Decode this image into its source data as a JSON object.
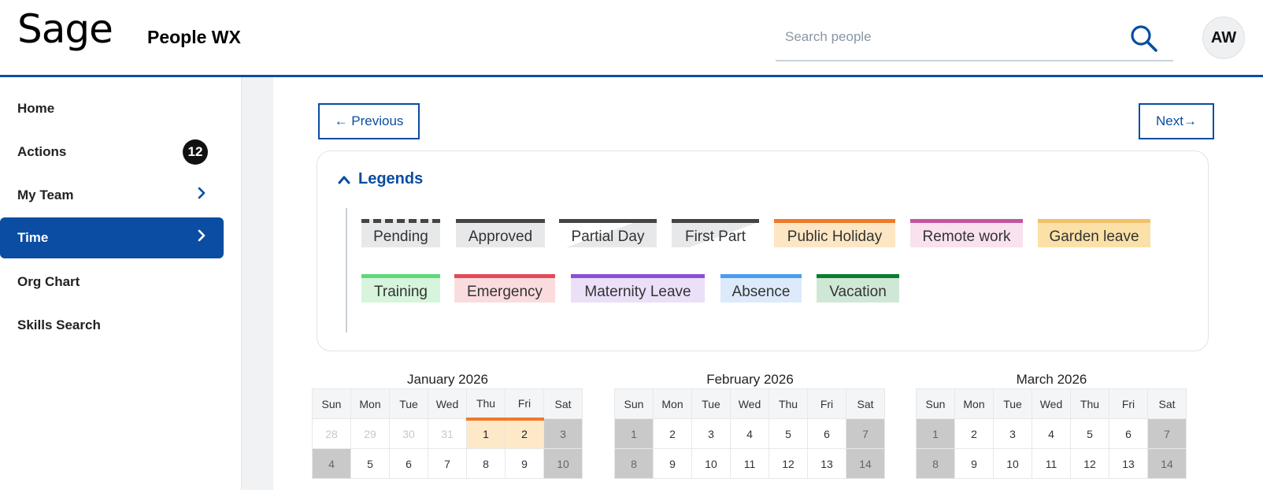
{
  "header": {
    "logo": "Sage",
    "app_title": "People WX",
    "search_placeholder": "Search people",
    "avatar_initials": "AW"
  },
  "sidebar": {
    "items": [
      {
        "label": "Home"
      },
      {
        "label": "Actions",
        "badge": "12"
      },
      {
        "label": "My Team"
      },
      {
        "label": "Time"
      },
      {
        "label": "Org Chart"
      },
      {
        "label": "Skills Search"
      }
    ]
  },
  "nav_buttons": {
    "previous": "← Previous",
    "next": "Next→"
  },
  "legends": {
    "title": "Legends",
    "chips": [
      {
        "label": "Pending",
        "accent": "#444444",
        "bg": "#e6e8ea",
        "style": "dashed"
      },
      {
        "label": "Approved",
        "accent": "#444444",
        "bg": "#e6e8ea"
      },
      {
        "label": "Partial Day",
        "accent": "#444444",
        "bg": "#e6e8ea",
        "style": "partial"
      },
      {
        "label": "First Part",
        "accent": "#444444",
        "bg": "#e6e8ea",
        "style": "first-part"
      },
      {
        "label": "Public Holiday",
        "accent": "#ee7a2a",
        "bg": "#fde6c4"
      },
      {
        "label": "Remote work",
        "accent": "#c2549f",
        "bg": "#f9e1ef"
      },
      {
        "label": "Garden leave",
        "accent": "#f2c06a",
        "bg": "#fbe1a8"
      },
      {
        "label": "Training",
        "accent": "#5fd97a",
        "bg": "#d6f5dc"
      },
      {
        "label": "Emergency",
        "accent": "#e24a57",
        "bg": "#fbdcde"
      },
      {
        "label": "Maternity Leave",
        "accent": "#8a4ed8",
        "bg": "#ebe0f8"
      },
      {
        "label": "Absence",
        "accent": "#4a9cf0",
        "bg": "#dceafb"
      },
      {
        "label": "Vacation",
        "accent": "#0a7d2c",
        "bg": "#cfe8d5"
      }
    ]
  },
  "weekdays": [
    "Sun",
    "Mon",
    "Tue",
    "Wed",
    "Thu",
    "Fri",
    "Sat"
  ],
  "calendars": [
    {
      "title": "January 2026",
      "rows": [
        [
          {
            "d": "28",
            "t": "other"
          },
          {
            "d": "29",
            "t": "other"
          },
          {
            "d": "30",
            "t": "other"
          },
          {
            "d": "31",
            "t": "other"
          },
          {
            "d": "1",
            "t": "holiday"
          },
          {
            "d": "2",
            "t": "holiday"
          },
          {
            "d": "3",
            "t": "wk"
          }
        ],
        [
          {
            "d": "4",
            "t": "wk"
          },
          {
            "d": "5"
          },
          {
            "d": "6"
          },
          {
            "d": "7"
          },
          {
            "d": "8"
          },
          {
            "d": "9"
          },
          {
            "d": "10",
            "t": "wk"
          }
        ]
      ]
    },
    {
      "title": "February 2026",
      "rows": [
        [
          {
            "d": "1",
            "t": "wk"
          },
          {
            "d": "2"
          },
          {
            "d": "3"
          },
          {
            "d": "4"
          },
          {
            "d": "5"
          },
          {
            "d": "6"
          },
          {
            "d": "7",
            "t": "wk"
          }
        ],
        [
          {
            "d": "8",
            "t": "wk"
          },
          {
            "d": "9"
          },
          {
            "d": "10"
          },
          {
            "d": "11"
          },
          {
            "d": "12"
          },
          {
            "d": "13"
          },
          {
            "d": "14",
            "t": "wk"
          }
        ]
      ]
    },
    {
      "title": "March 2026",
      "rows": [
        [
          {
            "d": "1",
            "t": "wk"
          },
          {
            "d": "2"
          },
          {
            "d": "3"
          },
          {
            "d": "4"
          },
          {
            "d": "5"
          },
          {
            "d": "6"
          },
          {
            "d": "7",
            "t": "wk"
          }
        ],
        [
          {
            "d": "8",
            "t": "wk"
          },
          {
            "d": "9"
          },
          {
            "d": "10"
          },
          {
            "d": "11"
          },
          {
            "d": "12"
          },
          {
            "d": "13"
          },
          {
            "d": "14",
            "t": "wk"
          }
        ]
      ]
    }
  ]
}
